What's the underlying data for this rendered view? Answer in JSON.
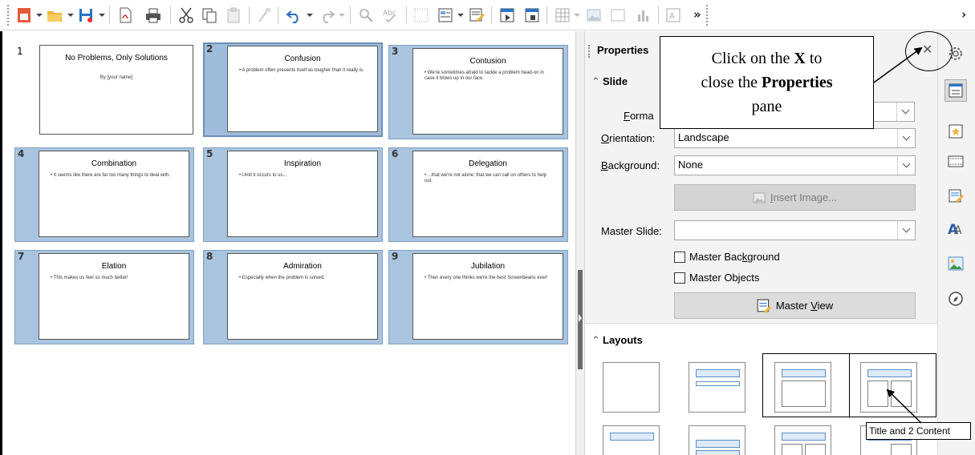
{
  "toolbar": {
    "overflow_label": "»",
    "far_overflow_label": "›"
  },
  "slides": [
    {
      "number": "1",
      "title": "No Problems, Only Solutions",
      "body": "",
      "center_text": "By [your name]"
    },
    {
      "number": "2",
      "title": "Confusion",
      "body": "• A problem often presents itself as tougher than it really is."
    },
    {
      "number": "3",
      "title": "Contusion",
      "body": "• We're sometimes afraid to tackle a problem head-on in case it blows up in our face."
    },
    {
      "number": "4",
      "title": "Combination",
      "body": "• It seems like there are far too many things to deal with."
    },
    {
      "number": "5",
      "title": "Inspiration",
      "body": "• Until it occurs to us..."
    },
    {
      "number": "6",
      "title": "Delegation",
      "body": "• ...that we're not alone; that we can call on others to help out."
    },
    {
      "number": "7",
      "title": "Elation",
      "body": "• This makes us feel so much better!"
    },
    {
      "number": "8",
      "title": "Admiration",
      "body": "• Especially when the problem is solved."
    },
    {
      "number": "9",
      "title": "Jubilation",
      "body": "• Then every one thinks we're the best Screenbeans ever!"
    }
  ],
  "panel": {
    "title": "Properties",
    "close_label": "✕",
    "slide_section": "Slide",
    "format_label_prefix": "F",
    "format_label_rest": "orma",
    "orientation_label_prefix": "O",
    "orientation_label_rest": "rientation:",
    "orientation_value": "Landscape",
    "background_label_prefix": "B",
    "background_label_rest": "ackground:",
    "background_value": "None",
    "insert_image_prefix": "I",
    "insert_image_rest": "nsert Image...",
    "master_slide_label": "Master Slide:",
    "master_slide_value": "",
    "master_background_a": "Master Bac",
    "master_background_u": "k",
    "master_background_b": "ground",
    "master_objects_label": "Master Objects",
    "master_view_a": "Master ",
    "master_view_u": "V",
    "master_view_b": "iew",
    "layouts_section": "Layouts"
  },
  "callout": {
    "line1_a": "Click on the ",
    "line1_b": "X",
    "line1_c": " to",
    "line2_a": "close the ",
    "line2_b": "Properties",
    "line3": "pane"
  },
  "tooltip": "Title and 2 Content",
  "colors": {
    "thumb_frame": "#a9c4df",
    "layout_accent": "#5a8ec7"
  }
}
